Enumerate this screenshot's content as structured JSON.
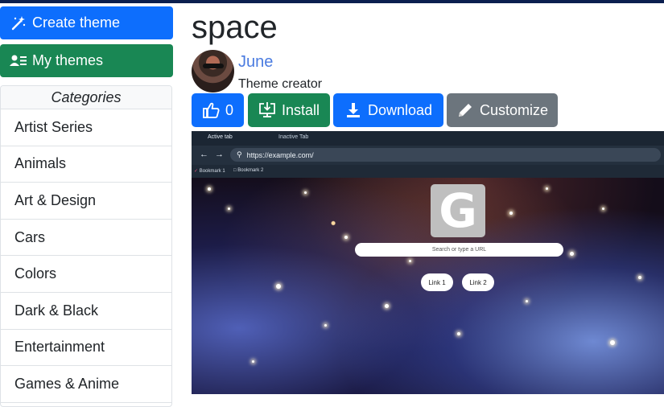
{
  "sidebar": {
    "create_label": "Create theme",
    "my_themes_label": "My themes",
    "categories_heading": "Categories",
    "categories": [
      "Artist Series",
      "Animals",
      "Art & Design",
      "Cars",
      "Colors",
      "Dark & Black",
      "Entertainment",
      "Games & Anime"
    ]
  },
  "theme": {
    "title": "space",
    "author": "June",
    "role": "Theme creator"
  },
  "actions": {
    "like_count": "0",
    "install_label": "Install",
    "download_label": "Download",
    "customize_label": "Customize"
  },
  "preview": {
    "active_tab": "Active tab",
    "inactive_tab": "Inactive Tab",
    "url": "https://example.com/",
    "bookmark1": "Bookmark 1",
    "bookmark2": "Bookmark 2",
    "ntp_logo": "G",
    "search_placeholder": "Search or type a URL",
    "link1": "Link 1",
    "link2": "Link 2"
  },
  "colors": {
    "primary": "#0d6efd",
    "success": "#198754",
    "secondary": "#6c757d",
    "author_link": "#4a7be0"
  },
  "icons": {
    "create": "magic-wand-icon",
    "my_themes": "person-list-icon",
    "like": "thumbs-up-icon",
    "install": "monitor-download-icon",
    "download": "download-icon",
    "customize": "pencil-icon"
  }
}
